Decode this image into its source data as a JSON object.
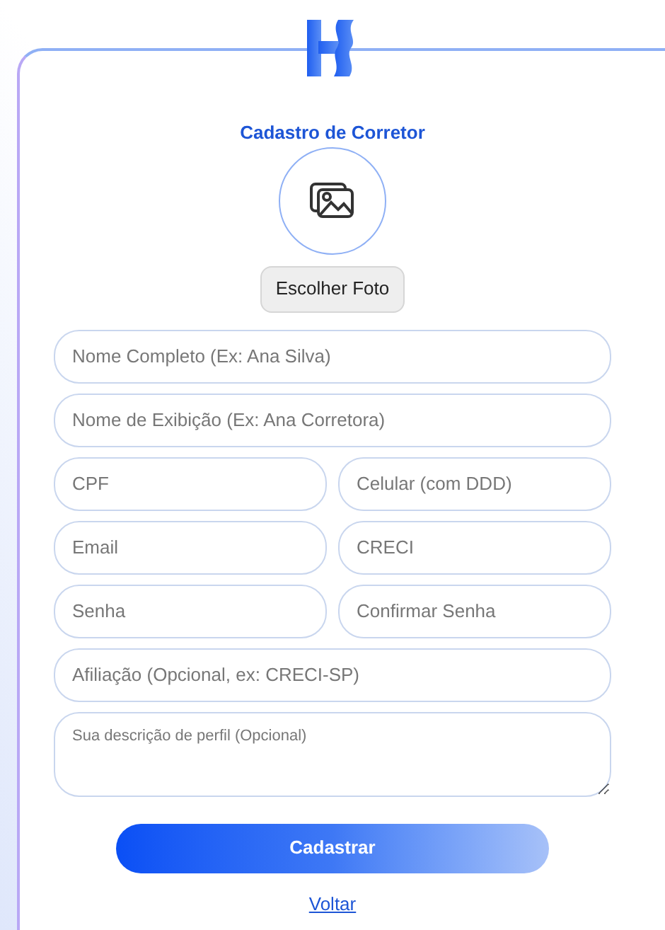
{
  "title": "Cadastro de Corretor",
  "photo_button": "Escolher Foto",
  "rows": [
    {
      "fields": [
        {
          "kind": "input",
          "placeholder": "Nome Completo (Ex: Ana Silva)"
        }
      ]
    },
    {
      "fields": [
        {
          "kind": "input",
          "placeholder": "Nome de Exibição (Ex: Ana Corretora)"
        }
      ]
    },
    {
      "fields": [
        {
          "kind": "input",
          "placeholder": "CPF"
        },
        {
          "kind": "input",
          "placeholder": "Celular (com DDD)"
        }
      ]
    },
    {
      "fields": [
        {
          "kind": "input",
          "placeholder": "Email"
        },
        {
          "kind": "input",
          "placeholder": "CRECI"
        }
      ]
    },
    {
      "fields": [
        {
          "kind": "input",
          "placeholder": "Senha"
        },
        {
          "kind": "input",
          "placeholder": "Confirmar Senha"
        }
      ]
    },
    {
      "fields": [
        {
          "kind": "input",
          "placeholder": "Afiliação (Opcional, ex: CRECI-SP)"
        }
      ]
    },
    {
      "fields": [
        {
          "kind": "textarea",
          "placeholder": "Sua descrição de perfil (Opcional)"
        }
      ]
    }
  ],
  "submit": "Cadastrar",
  "back_link": "Voltar"
}
